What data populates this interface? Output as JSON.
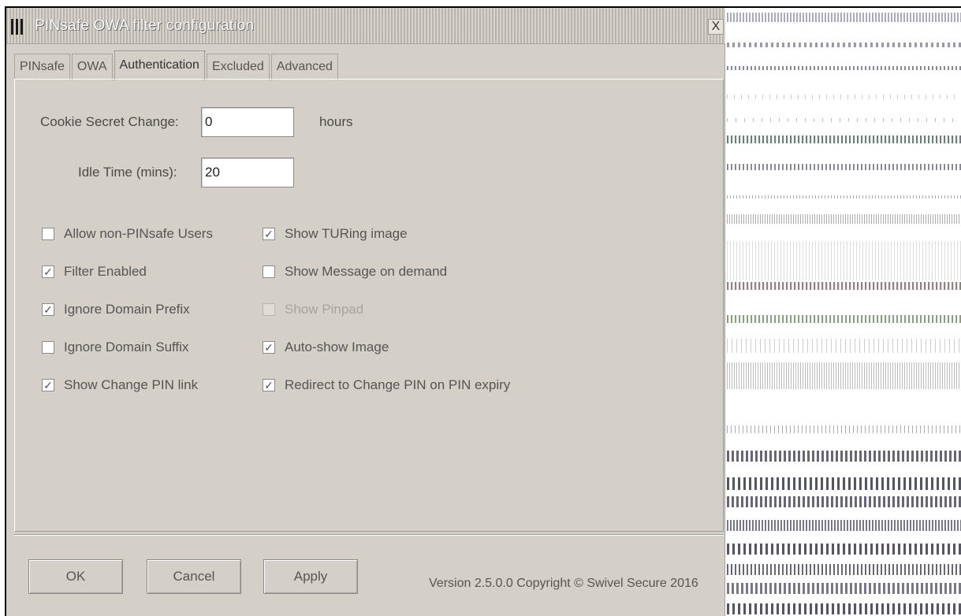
{
  "window": {
    "title": "PINsafe OWA filter configuration",
    "close_label": "X"
  },
  "tabs": [
    {
      "label": "PINsafe",
      "active": false
    },
    {
      "label": "OWA",
      "active": false
    },
    {
      "label": "Authentication",
      "active": true
    },
    {
      "label": "Excluded",
      "active": false
    },
    {
      "label": "Advanced",
      "active": false
    }
  ],
  "form": {
    "cookie_secret": {
      "label": "Cookie Secret Change:",
      "value": "0",
      "unit": "hours"
    },
    "idle_time": {
      "label": "Idle Time (mins):",
      "value": "20"
    }
  },
  "checkboxes_left": [
    {
      "label": "Allow non-PINsafe Users",
      "checked": false,
      "enabled": true
    },
    {
      "label": "Filter Enabled",
      "checked": true,
      "enabled": true
    },
    {
      "label": "Ignore Domain Prefix",
      "checked": true,
      "enabled": true
    },
    {
      "label": "Ignore Domain Suffix",
      "checked": false,
      "enabled": true
    },
    {
      "label": "Show Change PIN link",
      "checked": true,
      "enabled": true
    }
  ],
  "checkboxes_right": [
    {
      "label": "Show TURing image",
      "checked": true,
      "enabled": true
    },
    {
      "label": "Show Message on demand",
      "checked": false,
      "enabled": true
    },
    {
      "label": "Show Pinpad",
      "checked": false,
      "enabled": false
    },
    {
      "label": "Auto-show Image",
      "checked": true,
      "enabled": true
    },
    {
      "label": "Redirect to Change PIN on PIN expiry",
      "checked": true,
      "enabled": true
    }
  ],
  "buttons": {
    "ok": "OK",
    "cancel": "Cancel",
    "apply": "Apply"
  },
  "footer": {
    "version": "Version 2.5.0.0 Copyright © Swivel Secure 2016"
  },
  "colors": {
    "dialog_bg": "#d4d0c8",
    "text": "#555555"
  }
}
